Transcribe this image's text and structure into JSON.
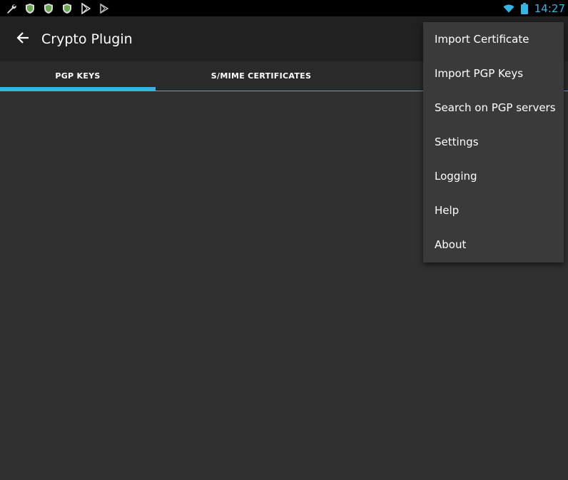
{
  "status_bar": {
    "time": "14:27",
    "colors": {
      "accent": "#33b5e5",
      "shield": "#6aa84f"
    },
    "icons": [
      "wrench-icon",
      "shield-icon",
      "shield-icon",
      "shield-icon",
      "play-store-icon",
      "play-store-icon",
      "wifi-icon",
      "battery-icon"
    ]
  },
  "action_bar": {
    "title": "Crypto Plugin",
    "back_icon": "arrow-left-icon"
  },
  "tabs": [
    {
      "label": "PGP KEYS",
      "selected": true
    },
    {
      "label": "S/MIME CERTIFICATES",
      "selected": false
    }
  ],
  "menu": {
    "items": [
      {
        "label": "Import Certificate"
      },
      {
        "label": "Import PGP Keys"
      },
      {
        "label": "Search on PGP servers"
      },
      {
        "label": "Settings"
      },
      {
        "label": "Logging"
      },
      {
        "label": "Help"
      },
      {
        "label": "About"
      }
    ]
  }
}
